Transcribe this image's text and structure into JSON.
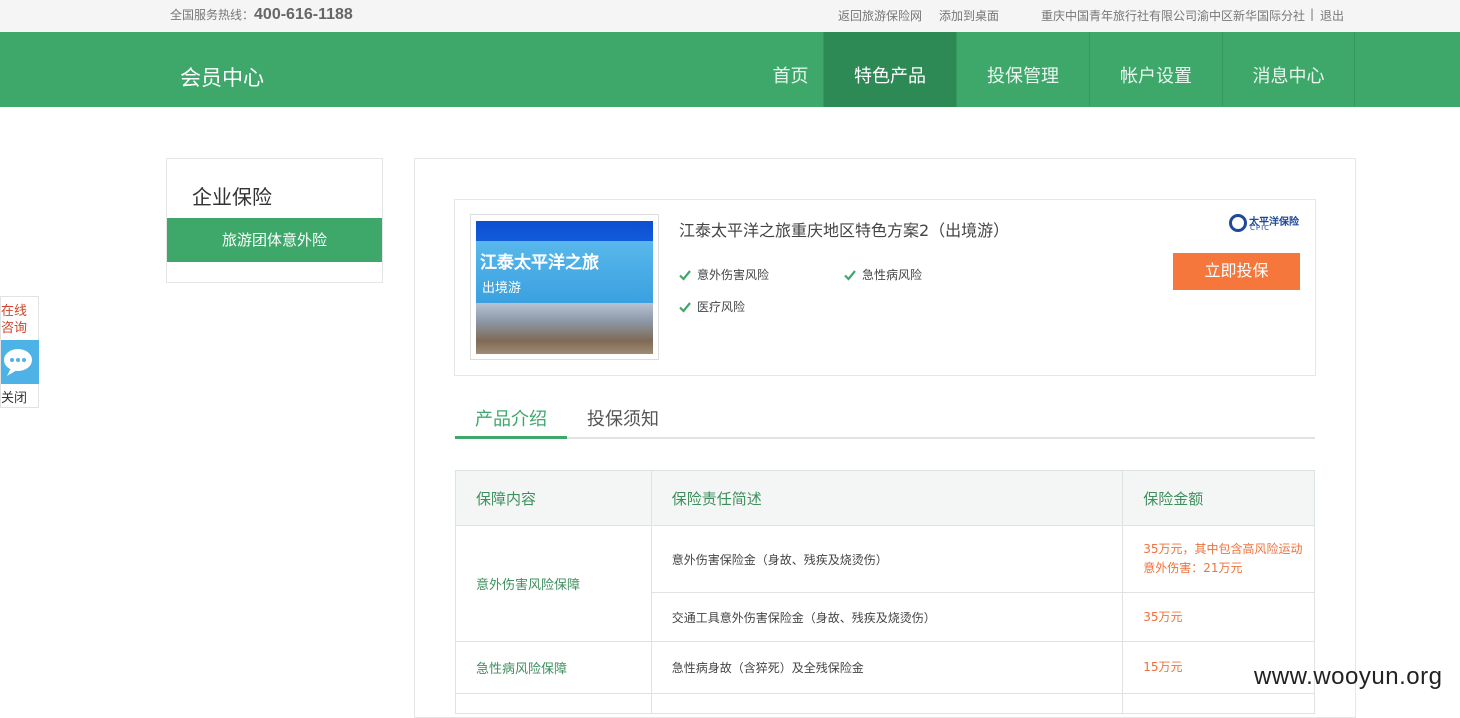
{
  "topbar": {
    "hotline_label": "全国服务热线：",
    "hotline_number": "400-616-1188",
    "back_link": "返回旅游保险网",
    "desktop_link": "添加到桌面",
    "agency": "重庆中国青年旅行社有限公司渝中区新华国际分社",
    "separator": "|",
    "logout": "退出"
  },
  "header": {
    "brand": "会员中心",
    "nav": [
      "首页",
      "特色产品",
      "投保管理",
      "帐户设置",
      "消息中心"
    ],
    "active_index": 1
  },
  "sidebar": {
    "title": "企业保险",
    "items": [
      "旅游团体意外险"
    ]
  },
  "product": {
    "image_title": "江泰太平洋之旅",
    "image_subtitle": "出境游",
    "title": "江泰太平洋之旅重庆地区特色方案2（出境游）",
    "features": [
      "意外伤害风险",
      "急性病风险",
      "医疗风险"
    ],
    "insurer_cn": "太平洋保险",
    "insurer_en": "CPIC",
    "buy_label": "立即投保"
  },
  "tabs": [
    "产品介绍",
    "投保须知"
  ],
  "table": {
    "headers": [
      "保障内容",
      "保险责任简述",
      "保险金额"
    ],
    "rows": [
      {
        "category": "意外伤害风险保障",
        "desc": "意外伤害保险金（身故、残疾及烧烫伤）",
        "amount_line1": "35万元，其中包含高风险运动",
        "amount_line2": "意外伤害：21万元"
      },
      {
        "category": "",
        "desc": "交通工具意外伤害保险金（身故、残疾及烧烫伤）",
        "amount_line1": "35万元",
        "amount_line2": ""
      },
      {
        "category": "急性病风险保障",
        "desc": "急性病身故（含猝死）及全残保险金",
        "amount_line1": "15万元",
        "amount_line2": ""
      }
    ]
  },
  "float": {
    "label_line1": "在线",
    "label_line2": "咨询",
    "close": "关闭"
  },
  "watermark": "www.wooyun.org",
  "colors": {
    "brand_green": "#3ea86b",
    "active_nav": "#2e8a55",
    "buy_orange": "#f5773c",
    "amount_orange": "#f0713a"
  }
}
